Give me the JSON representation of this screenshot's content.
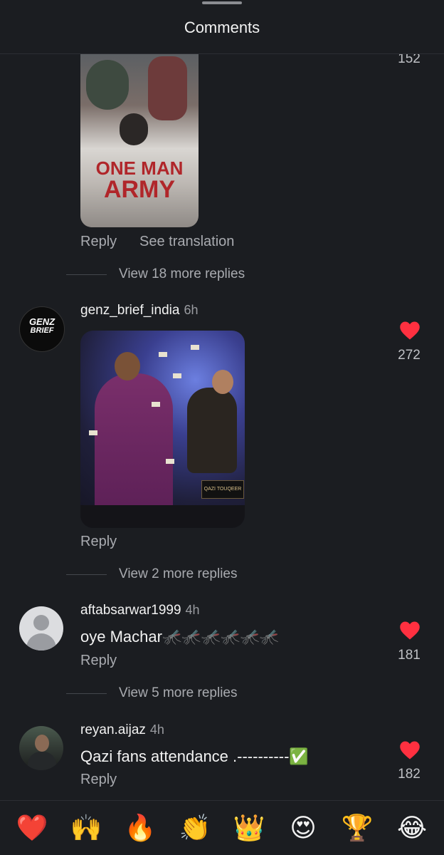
{
  "header": {
    "title": "Comments"
  },
  "thread_top": {
    "likes": "152",
    "image_caption_line1": "ONE MAN",
    "image_caption_line2": "ARMY",
    "reply_label": "Reply",
    "translate_label": "See translation",
    "more_replies": "View 18 more replies"
  },
  "comments": [
    {
      "username": "genz_brief_india",
      "time": "6h",
      "avatar_text1": "GENZ",
      "avatar_text2": "BRIEF",
      "image_sign": "QAZI TOUQEER",
      "likes": "272",
      "reply_label": "Reply",
      "more_replies": "View 2 more replies"
    },
    {
      "username": "aftabsarwar1999",
      "time": "4h",
      "text": "oye Machar🦟🦟🦟🦟🦟🦟",
      "likes": "181",
      "reply_label": "Reply",
      "more_replies": "View 5 more replies"
    },
    {
      "username": "reyan.aijaz",
      "time": "4h",
      "text": "Qazi fans attendance .----------✅",
      "likes": "182",
      "reply_label": "Reply"
    }
  ],
  "emoji_bar": [
    "❤️",
    "🙌",
    "🔥",
    "👏",
    "👑",
    "😍",
    "🏆",
    "😂"
  ],
  "colors": {
    "background": "#1b1d21",
    "like_red": "#ff3040",
    "muted": "#a9abb0"
  }
}
